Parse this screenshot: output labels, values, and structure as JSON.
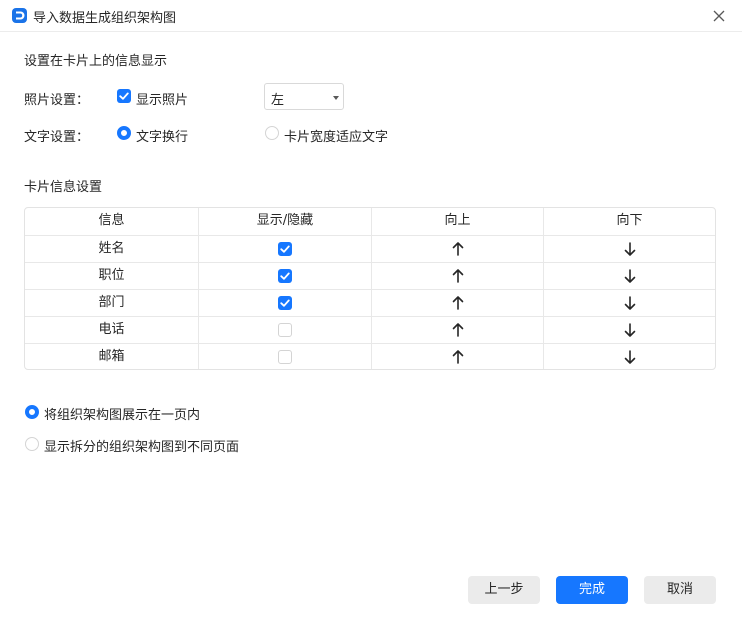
{
  "dialog": {
    "title": "导入数据生成组织架构图",
    "accent_color": "#1677ff"
  },
  "card_display": {
    "section_title": "设置在卡片上的信息显示",
    "photo_label": "照片设置：",
    "show_photo_label": "显示照片",
    "show_photo_checked": true,
    "photo_position_value": "左",
    "text_label": "文字设置：",
    "text_options": [
      {
        "label": "文字换行",
        "selected": true
      },
      {
        "label": "卡片宽度适应文字",
        "selected": false
      }
    ]
  },
  "card_info": {
    "section_title": "卡片信息设置",
    "columns": [
      "信息",
      "显示/隐藏",
      "向上",
      "向下"
    ],
    "rows": [
      {
        "name": "姓名",
        "visible": true
      },
      {
        "name": "职位",
        "visible": true
      },
      {
        "name": "部门",
        "visible": true
      },
      {
        "name": "电话",
        "visible": false
      },
      {
        "name": "邮箱",
        "visible": false
      }
    ]
  },
  "layout_options": [
    {
      "label": "将组织架构图展示在一页内",
      "selected": true
    },
    {
      "label": "显示拆分的组织架构图到不同页面",
      "selected": false
    }
  ],
  "footer": {
    "prev_label": "上一步",
    "finish_label": "完成",
    "cancel_label": "取消"
  }
}
